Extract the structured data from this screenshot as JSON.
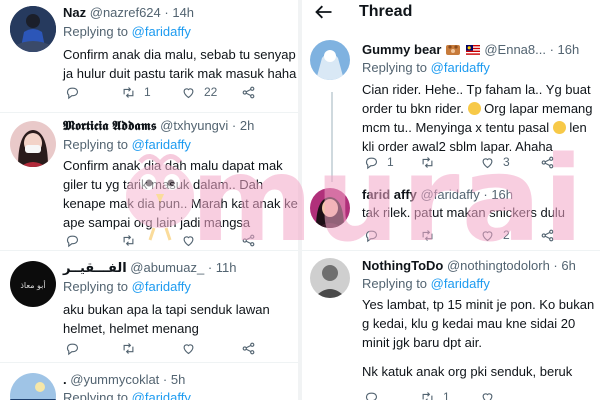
{
  "colors": {
    "accent": "#1d9bf0",
    "muted": "#536471",
    "text": "#0f1419",
    "watermark": "#f4a7c8"
  },
  "left": {
    "tweets": [
      {
        "name": "Naz",
        "handle": "@nazref624",
        "time": "· 14h",
        "replying": "Replying to",
        "mention": "@faridaffy",
        "lines": [
          "Confirm anak dia malu, sebab tu senyap",
          "ja hulur duit pastu tarik mak masuk haha"
        ],
        "retweets": "1",
        "likes": "22"
      },
      {
        "name": "𝕸𝖔𝖗𝖙𝖎𝖈𝖎𝖆 𝕬𝖉𝖉𝖆𝖒𝖘",
        "handle": "@txhyungvi",
        "time": "· 2h",
        "replying": "Replying to",
        "mention": "@faridaffy",
        "lines": [
          "Confirm anak dia dah malu dapat mak",
          "giler tu yg tarik masuk dalam.. Dah",
          "kenape mak dia pun.. Marah kat anak ke",
          "ape sampai org lain jadi mangsa"
        ]
      },
      {
        "name": "الفـــقيــر",
        "handle": "@abumuaz_",
        "time": "· 11h",
        "replying": "Replying to",
        "mention": "@faridaffy",
        "lines": [
          "aku bukan apa la tapi senduk lawan",
          "helmet, helmet menang"
        ]
      },
      {
        "name": ".",
        "handle": "@yummycoklat",
        "time": "· 5h",
        "replying": "Replying to",
        "mention": "@faridaffy"
      }
    ]
  },
  "right": {
    "title": "Thread",
    "tweets": [
      {
        "name": "Gummy bear",
        "handle": "@Enna8...",
        "time": "· 16h",
        "replying": "Replying to",
        "mention": "@faridaffy",
        "lines": [
          "Cian rider. Hehe.. Tp faham la.. Yg buat",
          "order tu bkn rider.",
          "Org lapar memang",
          "mcm tu.. Menyinga x tentu pasal",
          "len",
          "kli order awal2 sblm lapar. Ahaha"
        ],
        "replies": "1",
        "likes": "3"
      },
      {
        "name": "farid affy",
        "handle": "@faridaffy",
        "time": "· 16h",
        "lines": [
          "tak rilek. patut makan snickers dulu"
        ],
        "likes": "2"
      },
      {
        "name": "NothingToDo",
        "handle": "@nothingtodolorh",
        "time": "· 6h",
        "replying": "Replying to",
        "mention": "@faridaffy",
        "lines": [
          "Yes lambat, tp 15 minit je pon. Ko bukan",
          "g kedai, klu g kedai mau kne sidai 20",
          "minit jgk baru dpt air."
        ],
        "lines2": [
          "Nk katuk anak org pki senduk, beruk"
        ],
        "retweets": "1"
      }
    ]
  },
  "watermark_text": "murai"
}
